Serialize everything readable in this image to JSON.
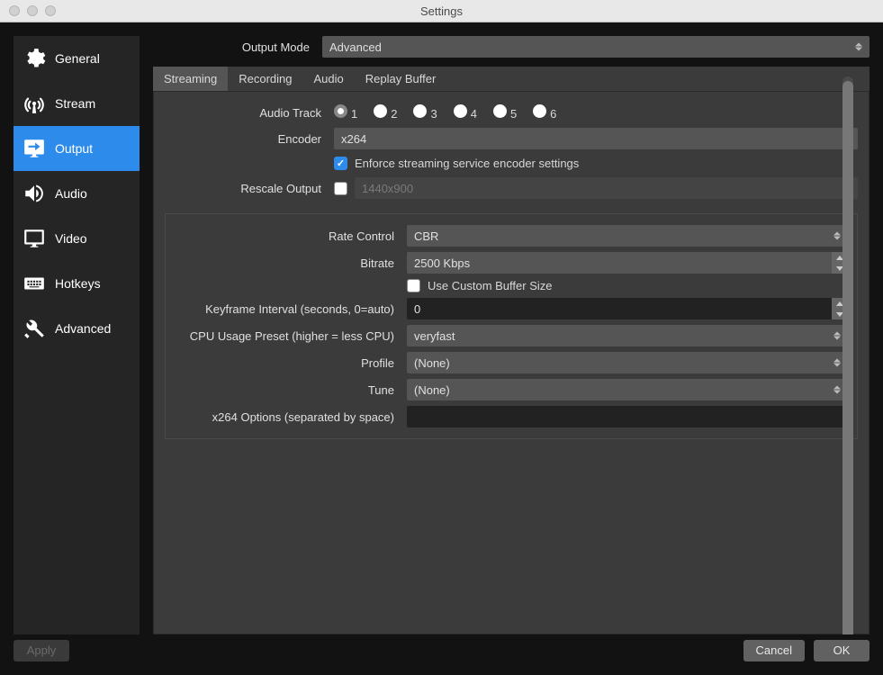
{
  "window": {
    "title": "Settings"
  },
  "sidebar": {
    "items": [
      {
        "label": "General"
      },
      {
        "label": "Stream"
      },
      {
        "label": "Output"
      },
      {
        "label": "Audio"
      },
      {
        "label": "Video"
      },
      {
        "label": "Hotkeys"
      },
      {
        "label": "Advanced"
      }
    ]
  },
  "outputMode": {
    "label": "Output Mode",
    "value": "Advanced"
  },
  "tabs": [
    {
      "label": "Streaming"
    },
    {
      "label": "Recording"
    },
    {
      "label": "Audio"
    },
    {
      "label": "Replay Buffer"
    }
  ],
  "audioTrack": {
    "label": "Audio Track",
    "options": [
      "1",
      "2",
      "3",
      "4",
      "5",
      "6"
    ],
    "selected": "1"
  },
  "encoder": {
    "label": "Encoder",
    "value": "x264"
  },
  "enforce": {
    "label": "Enforce streaming service encoder settings",
    "checked": true
  },
  "rescale": {
    "label": "Rescale Output",
    "checked": false,
    "value": "1440x900"
  },
  "rateControl": {
    "label": "Rate Control",
    "value": "CBR"
  },
  "bitrate": {
    "label": "Bitrate",
    "value": "2500 Kbps"
  },
  "customBuffer": {
    "label": "Use Custom Buffer Size",
    "checked": false
  },
  "keyframe": {
    "label": "Keyframe Interval (seconds, 0=auto)",
    "value": "0"
  },
  "cpuPreset": {
    "label": "CPU Usage Preset (higher = less CPU)",
    "value": "veryfast"
  },
  "profile": {
    "label": "Profile",
    "value": "(None)"
  },
  "tune": {
    "label": "Tune",
    "value": "(None)"
  },
  "x264opts": {
    "label": "x264 Options (separated by space)",
    "value": ""
  },
  "footer": {
    "apply": "Apply",
    "cancel": "Cancel",
    "ok": "OK"
  }
}
